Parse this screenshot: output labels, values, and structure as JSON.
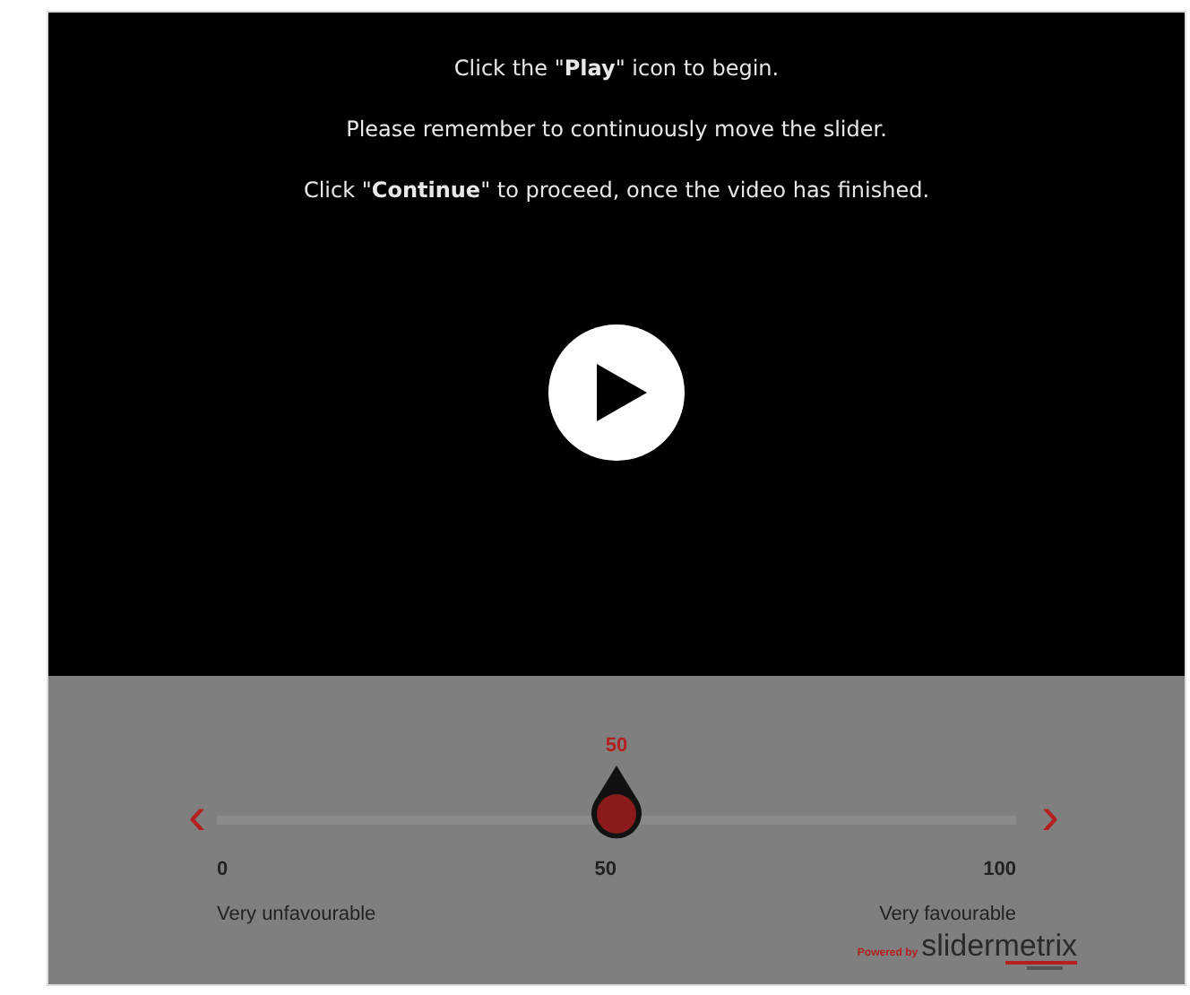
{
  "video": {
    "instructions": [
      "Click the \"**Play**\" icon to begin.",
      "Please remember to continuously move the slider.",
      "Click \"**Continue**\" to proceed, once the video has finished."
    ]
  },
  "slider": {
    "value": "50",
    "level": 0.5,
    "ticks": [
      "0",
      "50",
      "100"
    ],
    "min_label": "Very unfavourable",
    "max_label": "Very favourable",
    "left_arrow": "‹",
    "right_arrow": "›"
  },
  "branding": {
    "powered_by": "Powered by",
    "logo": "slidermetrix"
  }
}
